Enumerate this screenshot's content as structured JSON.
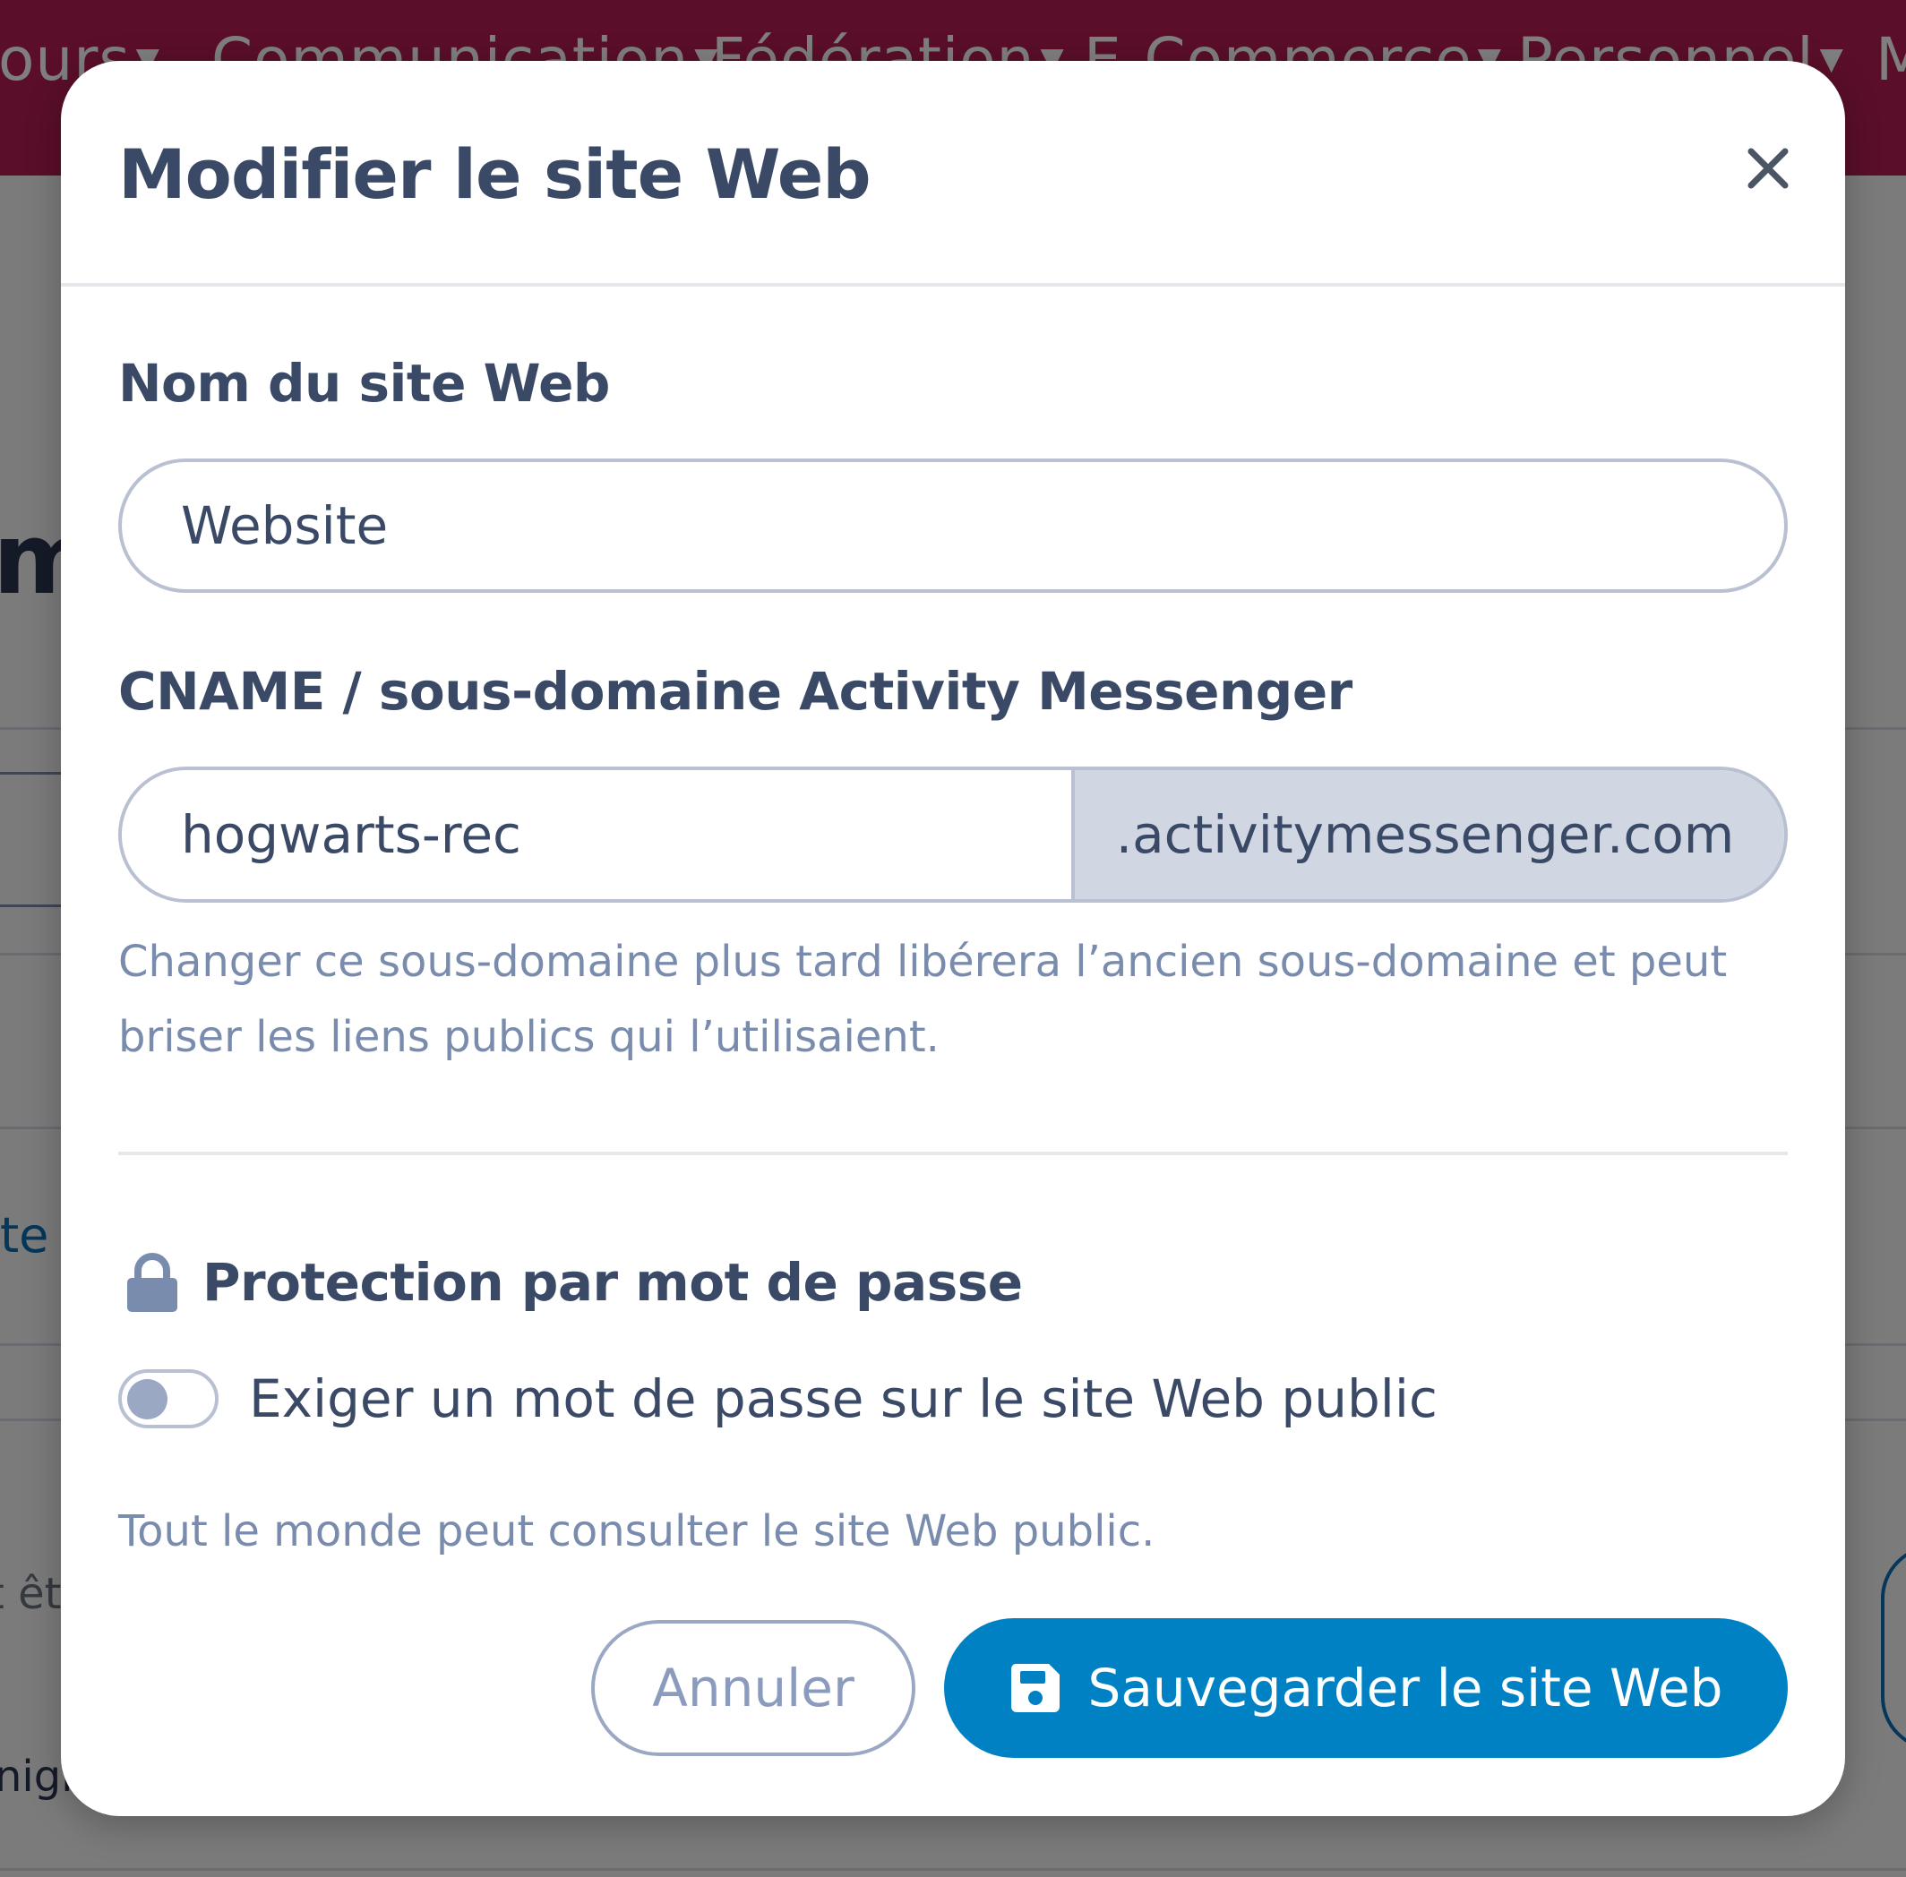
{
  "background": {
    "nav_items": [
      {
        "label": "ours"
      },
      {
        "label": "Communication"
      },
      {
        "label": "Fédération"
      },
      {
        "label": "E-Commerce"
      },
      {
        "label": "Personnel"
      },
      {
        "label": "M"
      }
    ],
    "fragments": {
      "heading": "m",
      "link": "te",
      "text": "t êt",
      "text2": "nigr"
    }
  },
  "modal": {
    "title": "Modifier le site Web",
    "close_icon": "close-icon",
    "site_name": {
      "label": "Nom du site Web",
      "value": "Website"
    },
    "cname": {
      "label": "CNAME / sous-domaine Activity Messenger",
      "value": "hogwarts-rec",
      "suffix": ".activitymessenger.com",
      "help": "Changer ce sous-domaine plus tard libérera l’ancien sous-domaine et peut briser les liens publics qui l’utilisaient."
    },
    "password": {
      "icon": "lock-icon",
      "title": "Protection par mot de passe",
      "toggle_label": "Exiger un mot de passe sur le site Web public",
      "toggle_on": false,
      "help": "Tout le monde peut consulter le site Web public."
    },
    "buttons": {
      "cancel": "Annuler",
      "save": "Sauvegarder le site Web",
      "save_icon": "floppy-disk-icon"
    }
  },
  "colors": {
    "nav": "#b51c53",
    "primary": "#0081c3",
    "text": "#3a4966",
    "muted": "#7a8cad"
  }
}
